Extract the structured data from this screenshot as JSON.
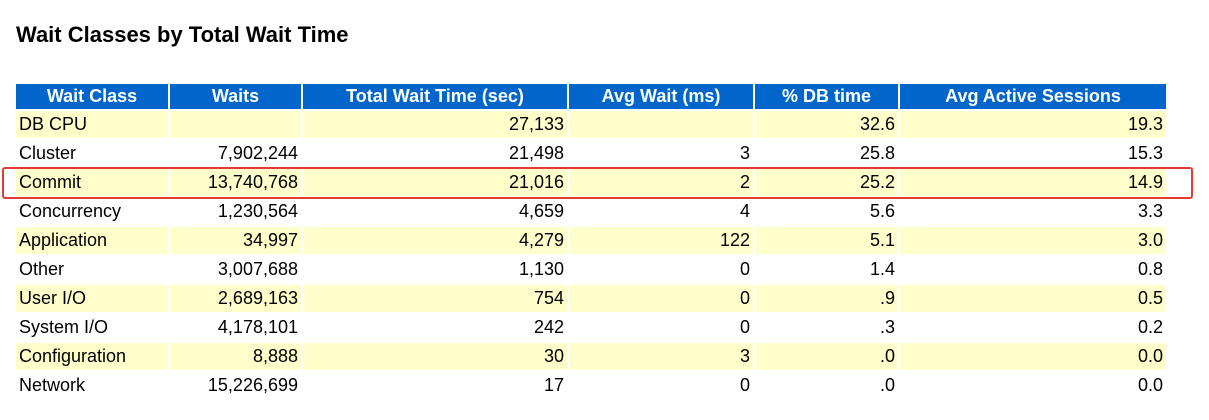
{
  "title": "Wait Classes by Total Wait Time",
  "columns": [
    "Wait Class",
    "Waits",
    "Total Wait Time (sec)",
    "Avg Wait (ms)",
    "% DB time",
    "Avg Active Sessions"
  ],
  "rows": [
    [
      "DB CPU",
      "",
      "27,133",
      "",
      "32.6",
      "19.3"
    ],
    [
      "Cluster",
      "7,902,244",
      "21,498",
      "3",
      "25.8",
      "15.3"
    ],
    [
      "Commit",
      "13,740,768",
      "21,016",
      "2",
      "25.2",
      "14.9"
    ],
    [
      "Concurrency",
      "1,230,564",
      "4,659",
      "4",
      "5.6",
      "3.3"
    ],
    [
      "Application",
      "34,997",
      "4,279",
      "122",
      "5.1",
      "3.0"
    ],
    [
      "Other",
      "3,007,688",
      "1,130",
      "0",
      "1.4",
      "0.8"
    ],
    [
      "User I/O",
      "2,689,163",
      "754",
      "0",
      ".9",
      "0.5"
    ],
    [
      "System I/O",
      "4,178,101",
      "242",
      "0",
      ".3",
      "0.2"
    ],
    [
      "Configuration",
      "8,888",
      "30",
      "3",
      ".0",
      "0.0"
    ],
    [
      "Network",
      "15,226,699",
      "17",
      "0",
      ".0",
      "0.0"
    ]
  ],
  "highlighted_row": "Commit",
  "colors": {
    "header_bg": "#0066cc",
    "header_text": "#ffffff",
    "alt_row_bg": "#ffffcc",
    "highlight_border": "#e53935"
  }
}
